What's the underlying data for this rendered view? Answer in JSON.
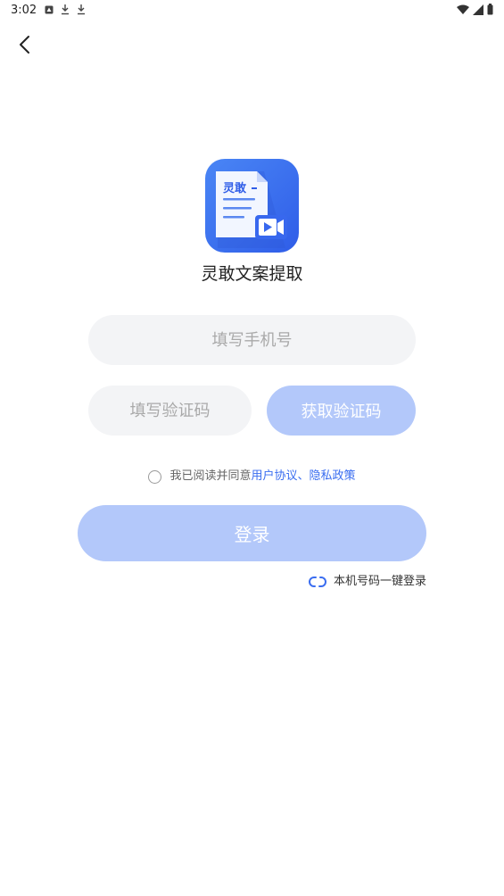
{
  "status_bar": {
    "time": "3:02",
    "left_icons": [
      "notification-icon",
      "download-icon",
      "download-icon"
    ],
    "right_icons": [
      "wifi-icon",
      "signal-icon",
      "battery-icon"
    ]
  },
  "nav": {
    "back_icon": "chevron-left-icon"
  },
  "app": {
    "logo_text": "灵敢",
    "name": "灵敢文案提取"
  },
  "form": {
    "phone_placeholder": "填写手机号",
    "phone_value": "",
    "code_placeholder": "填写验证码",
    "code_value": "",
    "get_code_label": "获取验证码"
  },
  "agreement": {
    "checked": false,
    "prefix": "我已阅读并同意",
    "user_agreement": "用户协议",
    "separator": "、",
    "privacy_policy": "隐私政策"
  },
  "login": {
    "label": "登录"
  },
  "one_click": {
    "icon": "link-icon",
    "label": "本机号码一键登录"
  },
  "colors": {
    "accent": "#3a6df0",
    "button_disabled": "#b3c8fa",
    "input_bg": "#f3f4f6",
    "logo_blue": "#3b6ef0"
  }
}
